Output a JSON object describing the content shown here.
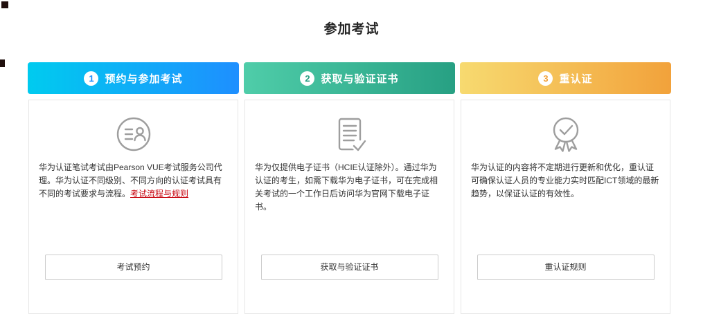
{
  "page": {
    "title": "参加考试"
  },
  "colors": {
    "link": "#C7000B",
    "icon": "#9E9E9E",
    "card_border": "#E6E6E6",
    "body_text": "#333333",
    "header_text": "#FFFFFF"
  },
  "steps": [
    {
      "number": "1",
      "title": "预约与参加考试",
      "gradient_start": "#00CBEF",
      "gradient_end": "#1E8FFF",
      "number_color": "#1E8FFF",
      "icon": "id-card-contact-icon",
      "text": "华为认证笔试考试由Pearson VUE考试服务公司代理。华为认证不同级别、不同方向的认证考试具有不同的考试要求与流程。",
      "link_text": "考试流程与规则",
      "button_label": "考试预约"
    },
    {
      "number": "2",
      "title": "获取与验证证书",
      "gradient_start": "#4FCDA9",
      "gradient_end": "#27A083",
      "number_color": "#27A083",
      "icon": "certificate-document-check-icon",
      "text": "华为仅提供电子证书（HCIE认证除外）。通过华为认证的考生，如需下载华为电子证书，可在完成相关考试的一个工作日后访问华为官网下载电子证书。",
      "button_label": "获取与验证证书"
    },
    {
      "number": "3",
      "title": "重认证",
      "gradient_start": "#F7DA70",
      "gradient_end": "#F2A23B",
      "number_color": "#F2A23B",
      "icon": "medal-check-icon",
      "text": "华为认证的内容将不定期进行更新和优化，重认证可确保认证人员的专业能力实时匹配ICT领域的最新趋势，以保证认证的有效性。",
      "button_label": "重认证规则"
    }
  ]
}
